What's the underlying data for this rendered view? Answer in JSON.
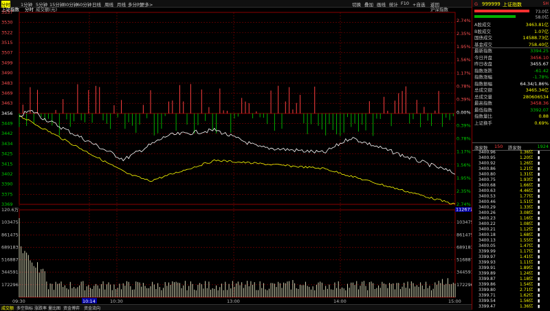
{
  "toolbar": {
    "tabs": [
      "分时",
      "1分钟",
      "5分钟",
      "15分钟",
      "30分钟",
      "60分钟",
      "日线",
      "周线",
      "月线",
      "多分时",
      "更多>"
    ],
    "right_buttons": [
      "切换",
      "叠加",
      "画线",
      "统计",
      "F10",
      "+自选",
      "返回"
    ]
  },
  "chart": {
    "title_left": "上证指数",
    "title_tab": "分时",
    "title_sub": "成交额(元)",
    "title_right": "沪深指数",
    "price_ticks_left": [
      "3537",
      "3530",
      "3522",
      "3515",
      "3507",
      "3499",
      "3490",
      "3483",
      "3469",
      "3463",
      "3456",
      "3449",
      "3442",
      "3434",
      "3425",
      "3415",
      "3402",
      "3390",
      "3375",
      "3369"
    ],
    "pct_ticks_right": [
      "2.74%",
      "2.35%",
      "1.95%",
      "1.56%",
      "1.17%",
      "0.78%",
      "0.39%",
      "0.00%",
      "0.39%",
      "0.78%",
      "1.17%",
      "1.56%",
      "1.95%",
      "2.35%",
      "2.74%"
    ],
    "vol_ticks_left": [
      "120.6万",
      "103475",
      "861475",
      "689183",
      "516887",
      "344591",
      "172296"
    ],
    "vol_ticks_right": [
      "120.6万",
      "103475",
      "861475",
      "689183",
      "516887",
      "344591",
      "172296"
    ],
    "vol_marker": "112677",
    "time_ticks": [
      "09:30",
      "10:14",
      "10:30",
      "13:00",
      "14:00",
      "15:00"
    ],
    "prev_close_label": "3456"
  },
  "bottom_tabs": [
    "成交额",
    "多空指标",
    "涨跌率",
    "量比图",
    "资金博弈",
    "资金流向"
  ],
  "sidebar": {
    "code": "999999",
    "name": "上证指数",
    "flag": "SH",
    "bars": [
      {
        "v": "73.0亿"
      },
      {
        "v": "58.0亿"
      }
    ],
    "stats": [
      {
        "l": "A股成交",
        "v": "3463.81亿",
        "c": "yel"
      },
      {
        "l": "B股成交",
        "v": "1.07亿",
        "c": "yel"
      },
      {
        "l": "国债成交",
        "v": "14588.73亿",
        "c": "yel"
      },
      {
        "l": "基金成交",
        "v": "758.40亿",
        "c": "yel"
      },
      {
        "l": "最新指数",
        "v": "3394.25",
        "c": "grn"
      },
      {
        "l": "今日开盘",
        "v": "3456.10",
        "c": "red"
      },
      {
        "l": "昨日收盘",
        "v": "3455.67",
        "c": "wht"
      },
      {
        "l": "指数涨跌",
        "v": "-61.42",
        "c": "grn"
      },
      {
        "l": "指数涨幅",
        "v": "-1.78%",
        "c": "grn"
      },
      {
        "l": "指数振幅",
        "v": "64.34/1.86%",
        "c": "wht"
      },
      {
        "l": "总成交额",
        "v": "3465.34亿",
        "c": "yel"
      },
      {
        "l": "总成交量",
        "v": "280606534",
        "c": "yel"
      },
      {
        "l": "最高指数",
        "v": "3458.36",
        "c": "red"
      },
      {
        "l": "最低指数",
        "v": "3392.07",
        "c": "grn"
      },
      {
        "l": "指数量比",
        "v": "0.88",
        "c": "yel"
      },
      {
        "l": "上证换手",
        "v": "0.69%",
        "c": "yel"
      }
    ],
    "breadth": {
      "up_label": "涨家数",
      "up": "150",
      "down_label": "跌家数",
      "down": "1924"
    },
    "ticks": [
      {
        "p": "3400.96",
        "q": "1.36亿"
      },
      {
        "p": "3400.95",
        "q": "1.20亿"
      },
      {
        "p": "3400.92",
        "q": "1.26亿"
      },
      {
        "p": "3400.86",
        "q": "1.21亿"
      },
      {
        "p": "3400.80",
        "q": "1.31亿"
      },
      {
        "p": "3400.75",
        "q": "1.93亿"
      },
      {
        "p": "3400.68",
        "q": "1.66亿"
      },
      {
        "p": "3400.63",
        "q": "4.46亿"
      },
      {
        "p": "3400.53",
        "q": "1.77亿"
      },
      {
        "p": "3400.46",
        "q": "1.51亿"
      },
      {
        "p": "3400.29",
        "q": "1.33亿"
      },
      {
        "p": "3400.26",
        "q": "3.08亿"
      },
      {
        "p": "3400.23",
        "q": "1.16亿"
      },
      {
        "p": "3400.22",
        "q": "1.08亿"
      },
      {
        "p": "3400.21",
        "q": "1.12亿"
      },
      {
        "p": "3400.18",
        "q": "1.68亿"
      },
      {
        "p": "3400.13",
        "q": "1.55亿"
      },
      {
        "p": "3400.05",
        "q": "1.47亿"
      },
      {
        "p": "3399.99",
        "q": "1.17亿"
      },
      {
        "p": "3399.97",
        "q": "1.41亿"
      },
      {
        "p": "3399.93",
        "q": "1.11亿"
      },
      {
        "p": "3399.91",
        "q": "1.89亿"
      },
      {
        "p": "3399.89",
        "q": "1.24亿"
      },
      {
        "p": "3399.87",
        "q": "1.18亿"
      },
      {
        "p": "3399.86",
        "q": "1.54亿"
      },
      {
        "p": "3399.80",
        "q": "2.71亿"
      },
      {
        "p": "3399.71",
        "q": "1.62亿"
      },
      {
        "p": "3399.54",
        "q": "1.56亿"
      },
      {
        "p": "3399.47",
        "q": "1.36亿"
      }
    ]
  },
  "colors": {
    "up": "#ff4040",
    "down": "#00c000",
    "price_line": "#ffffff",
    "avg_line": "#ffff00",
    "grid": "#8b0000"
  }
}
